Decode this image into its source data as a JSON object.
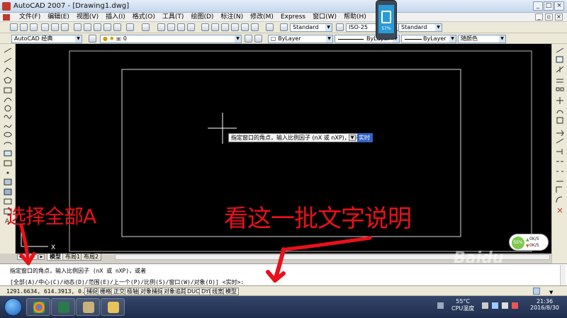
{
  "window": {
    "title": "AutoCAD 2007 - [Drawing1.dwg]",
    "min_glyph": "_",
    "max_glyph": "□",
    "close_glyph": "×"
  },
  "menu": {
    "items": [
      "文件(F)",
      "编辑(E)",
      "视图(V)",
      "插入(I)",
      "格式(O)",
      "工具(T)",
      "绘图(D)",
      "标注(N)",
      "修改(M)",
      "窗口(W)",
      "帮助(H)"
    ],
    "express": "Express",
    "items_after": [
      "窗口(W)",
      "帮助(H)"
    ]
  },
  "toolbar": {
    "text_style": "Standard",
    "dim_style": "ISO-25",
    "table_style": "Standard",
    "workspace": "AutoCAD 经典",
    "layer": "0",
    "color": "ByLayer",
    "linetype": "ByLayer",
    "lineweight": "ByLayer",
    "plot_style": "随颜色"
  },
  "canvas": {
    "background": "#000000",
    "ucs_x_label": "X",
    "dynamic_prompt": "指定窗口的角点，输入比例因子 (nX 或 nXP)，或者",
    "dynamic_input": "实时"
  },
  "layout_tabs": [
    "模型",
    "布局1",
    "布局2"
  ],
  "command": {
    "line1": "指定窗口的角点，输入比例因子 (nX 或 nXP)，或者",
    "line2": "[全部(A)/中心(C)/动态(D)/范围(E)/上一个(P)/比例(S)/窗口(W)/对象(O)] <实时>:"
  },
  "status": {
    "coords": "1291.6634, 614.3913, 0.0000",
    "buttons": [
      "捕捉",
      "栅格",
      "正交",
      "极轴",
      "对象捕捉",
      "对象追踪",
      "DUCS",
      "DYN",
      "线宽",
      "模型"
    ]
  },
  "network": {
    "percent": "55%",
    "up": "0K/S",
    "down": "0K/S"
  },
  "phone": {
    "battery": "57%"
  },
  "taskbar": {
    "cpu_temp": "55°C",
    "cpu_label": "CPU温度",
    "time": "21:36",
    "date": "2016/8/30"
  },
  "annotations": {
    "left": "选择全部A",
    "right": "看这一批文字说明",
    "color": "#e8111a"
  },
  "watermark": "Baidu"
}
